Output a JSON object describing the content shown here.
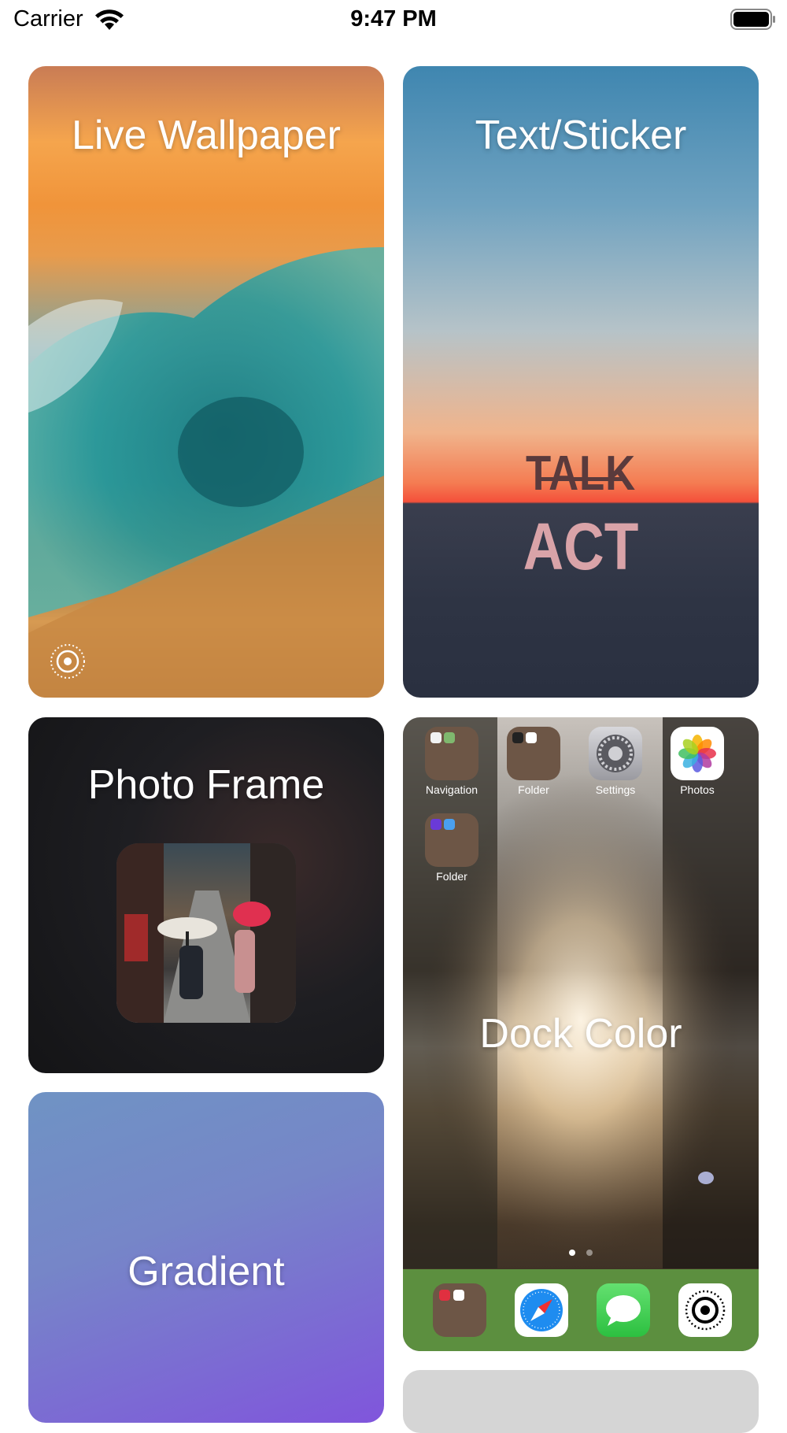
{
  "status_bar": {
    "carrier": "Carrier",
    "time": "9:47 PM"
  },
  "cards": {
    "live_wallpaper": {
      "title": "Live Wallpaper"
    },
    "text_sticker": {
      "title": "Text/Sticker",
      "sticker_line1": "TALK",
      "sticker_line2": "ACT"
    },
    "photo_frame": {
      "title": "Photo Frame"
    },
    "gradient": {
      "title": "Gradient"
    },
    "dock_color": {
      "title": "Dock Color",
      "home_apps": [
        {
          "label": "Navigation",
          "icon": "folder-icon"
        },
        {
          "label": "Folder",
          "icon": "folder-icon"
        },
        {
          "label": "Settings",
          "icon": "settings-icon"
        },
        {
          "label": "Photos",
          "icon": "photos-icon"
        },
        {
          "label": "Folder",
          "icon": "folder-icon"
        }
      ],
      "dock_apps": [
        "folder-icon",
        "safari-icon",
        "messages-icon",
        "live-photo-icon"
      ],
      "dock_color": "#5c8f3f",
      "page_count": 2,
      "current_page": 1
    }
  },
  "colors": {
    "gradient_start": "#6f93c4",
    "gradient_end": "#8055dc",
    "dock": "#5c8f3f"
  }
}
